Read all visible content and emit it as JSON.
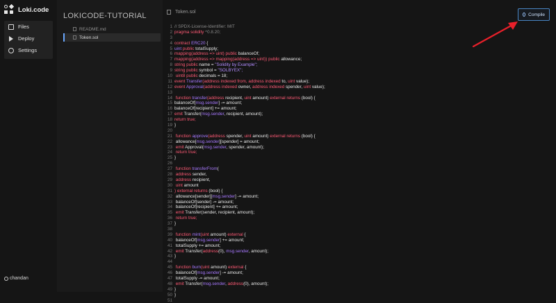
{
  "app": {
    "name": "Loki.code"
  },
  "nav": {
    "items": [
      {
        "label": "Files",
        "icon": "folder-icon"
      },
      {
        "label": "Deploy",
        "icon": "deploy-icon"
      },
      {
        "label": "Settings",
        "icon": "gear-icon"
      }
    ]
  },
  "user": {
    "name": "chandan"
  },
  "explorer": {
    "title": "LOKICODE-TUTORIAL",
    "files": [
      {
        "name": "README.md",
        "active": false
      },
      {
        "name": "Token.sol",
        "active": true
      }
    ]
  },
  "editor": {
    "tab_label": "Token.sol",
    "compile_label": "Compile",
    "code_lines": [
      [
        [
          "// SPDX-License-Identifier: MIT",
          "cmt"
        ]
      ],
      [
        [
          "pragma solidity ",
          "kw"
        ],
        [
          "^0.8.20;",
          "cmt"
        ]
      ],
      [],
      [
        [
          "contract ",
          "kw"
        ],
        [
          "ERC20 ",
          "fn"
        ],
        [
          "{",
          "id"
        ]
      ],
      [
        [
          "uint ",
          "fn"
        ],
        [
          "public ",
          "kw"
        ],
        [
          "totalSupply;",
          "id"
        ]
      ],
      [
        [
          "mapping(address => uint) public ",
          "kw"
        ],
        [
          "balanceOf;",
          "id"
        ]
      ],
      [
        [
          "mapping(address => mapping(address => uint)) public ",
          "kw"
        ],
        [
          "allowance;",
          "id"
        ]
      ],
      [
        [
          "string public ",
          "kw"
        ],
        [
          "name = ",
          "id"
        ],
        [
          "\"Solidity by Example\";",
          "str"
        ]
      ],
      [
        [
          "string public ",
          "kw"
        ],
        [
          "symbol = ",
          "id"
        ],
        [
          "\"SOLBYEX\";",
          "str"
        ]
      ],
      [
        [
          " uint8 public ",
          "kw"
        ],
        [
          "decimals = 18;",
          "id"
        ]
      ],
      [
        [
          "event ",
          "kw"
        ],
        [
          "Transfer",
          "fn"
        ],
        [
          "(address indexed from, address indexed ",
          "kw"
        ],
        [
          "to, ",
          "id"
        ],
        [
          "uint ",
          "kw"
        ],
        [
          "value);",
          "id"
        ]
      ],
      [
        [
          "event ",
          "kw"
        ],
        [
          "Approval",
          "fn"
        ],
        [
          "(address indexed ",
          "kw"
        ],
        [
          "owner, ",
          "id"
        ],
        [
          "address indexed ",
          "kw"
        ],
        [
          "spender, ",
          "id"
        ],
        [
          "uint ",
          "kw"
        ],
        [
          "value);",
          "id"
        ]
      ],
      [],
      [
        [
          " function ",
          "kw"
        ],
        [
          "transfer",
          "fn"
        ],
        [
          "(address ",
          "kw"
        ],
        [
          "recipient, ",
          "id"
        ],
        [
          "uint ",
          "kw"
        ],
        [
          "amount) ",
          "id"
        ],
        [
          "external returns ",
          "kw"
        ],
        [
          "(bool) {",
          "id"
        ]
      ],
      [
        [
          "balanceOf[",
          "id"
        ],
        [
          "msg.sender",
          "fn"
        ],
        [
          "] -= amount;",
          "id"
        ]
      ],
      [
        [
          "balanceOf[recipient] += amount;",
          "id"
        ]
      ],
      [
        [
          "emit ",
          "kw"
        ],
        [
          "Transfer(",
          "id"
        ],
        [
          "msg.sender",
          "fn"
        ],
        [
          ", recipient, amount);",
          "id"
        ]
      ],
      [
        [
          "return true;",
          "kw"
        ]
      ],
      [
        [
          "}",
          "id"
        ]
      ],
      [],
      [
        [
          " function ",
          "kw"
        ],
        [
          "approve",
          "fn"
        ],
        [
          "(address ",
          "kw"
        ],
        [
          "spender, ",
          "id"
        ],
        [
          "uint ",
          "kw"
        ],
        [
          "amount) ",
          "id"
        ],
        [
          "external returns ",
          "kw"
        ],
        [
          "(bool) {",
          "id"
        ]
      ],
      [
        [
          " allowance[",
          "id"
        ],
        [
          "msg.sender",
          "fn"
        ],
        [
          "][spender] = amount;",
          "id"
        ]
      ],
      [
        [
          " emit ",
          "kw"
        ],
        [
          "Approval(",
          "id"
        ],
        [
          "msg.sender",
          "fn"
        ],
        [
          ", spender, amount);",
          "id"
        ]
      ],
      [
        [
          " return true;",
          "kw"
        ]
      ],
      [
        [
          "}",
          "id"
        ]
      ],
      [],
      [
        [
          " function ",
          "kw"
        ],
        [
          "transferFrom",
          "fn"
        ],
        [
          "(",
          "id"
        ]
      ],
      [
        [
          " address ",
          "kw"
        ],
        [
          "sender,",
          "id"
        ]
      ],
      [
        [
          " address ",
          "kw"
        ],
        [
          "recipient,",
          "id"
        ]
      ],
      [
        [
          " uint ",
          "kw"
        ],
        [
          "amount",
          "id"
        ]
      ],
      [
        [
          ") external returns ",
          "kw"
        ],
        [
          "(bool) {",
          "id"
        ]
      ],
      [
        [
          " allowance[sender][",
          "id"
        ],
        [
          "msg.sender",
          "fn"
        ],
        [
          "] -= amount;",
          "id"
        ]
      ],
      [
        [
          " balanceOf[sender] -= amount;",
          "id"
        ]
      ],
      [
        [
          " balanceOf[recipient] += amount;",
          "id"
        ]
      ],
      [
        [
          " emit ",
          "kw"
        ],
        [
          "Transfer(sender, recipient, amount);",
          "id"
        ]
      ],
      [
        [
          " return true;",
          "kw"
        ]
      ],
      [
        [
          "}",
          "id"
        ]
      ],
      [],
      [
        [
          " function ",
          "kw"
        ],
        [
          "mint",
          "fn"
        ],
        [
          "(uint ",
          "kw"
        ],
        [
          "amount) ",
          "id"
        ],
        [
          "external ",
          "kw"
        ],
        [
          "{",
          "id"
        ]
      ],
      [
        [
          " balanceOf[",
          "id"
        ],
        [
          "msg.sender",
          "fn"
        ],
        [
          "] += amount;",
          "id"
        ]
      ],
      [
        [
          " totalSupply += amount;",
          "id"
        ]
      ],
      [
        [
          " emit ",
          "kw"
        ],
        [
          "Transfer(",
          "id"
        ],
        [
          "address",
          "kw"
        ],
        [
          "(0), ",
          "id"
        ],
        [
          "msg.sender",
          "fn"
        ],
        [
          ", amount);",
          "id"
        ]
      ],
      [
        [
          "}",
          "id"
        ]
      ],
      [],
      [
        [
          " function ",
          "kw"
        ],
        [
          "burn",
          "fn"
        ],
        [
          "(uint ",
          "kw"
        ],
        [
          "amount) ",
          "id"
        ],
        [
          "external ",
          "kw"
        ],
        [
          "{",
          "id"
        ]
      ],
      [
        [
          " balanceOf[",
          "id"
        ],
        [
          "msg.sender",
          "fn"
        ],
        [
          "] -= amount;",
          "id"
        ]
      ],
      [
        [
          " totalSupply -= amount;",
          "id"
        ]
      ],
      [
        [
          " emit ",
          "kw"
        ],
        [
          "Transfer(",
          "id"
        ],
        [
          "msg.sender",
          "fn"
        ],
        [
          ", ",
          "id"
        ],
        [
          "address",
          "kw"
        ],
        [
          "(0), amount);",
          "id"
        ]
      ],
      [
        [
          "}",
          "id"
        ]
      ],
      [
        [
          "}",
          "id"
        ]
      ],
      []
    ]
  },
  "colors": {
    "background": "#151515",
    "keyword": "#ff5a75",
    "function": "#a879ff",
    "accent": "#4a86c5",
    "annotation": "#e8202a"
  }
}
